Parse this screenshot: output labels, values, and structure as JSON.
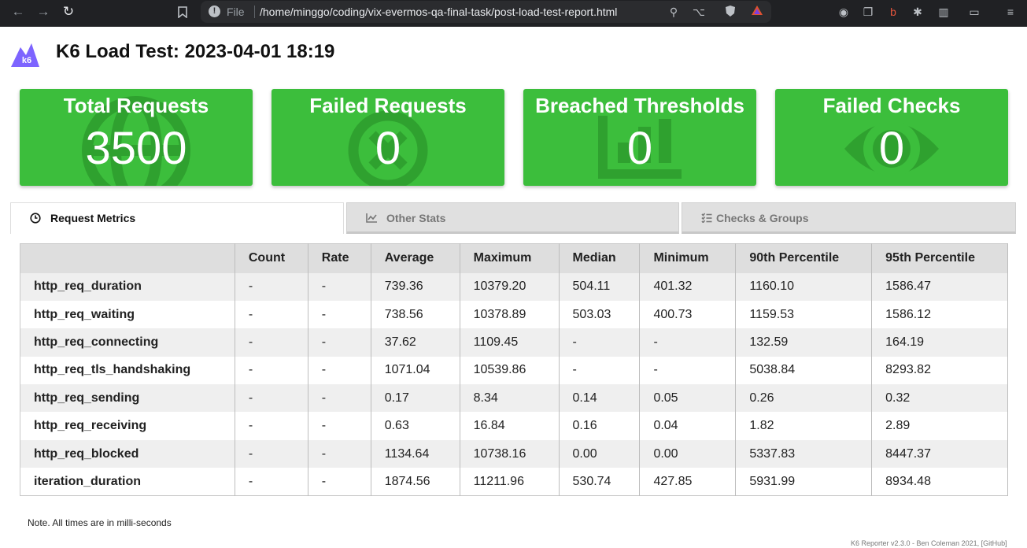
{
  "browser": {
    "file_label": "File",
    "url": "/home/minggo/coding/vix-evermos-qa-final-task/post-load-test-report.html"
  },
  "header": {
    "logo_text": "k6",
    "title": "K6 Load Test: 2023-04-01 18:19"
  },
  "cards": [
    {
      "title": "Total Requests",
      "value": "3500",
      "icon": "globe-icon"
    },
    {
      "title": "Failed Requests",
      "value": "0",
      "icon": "x-circle-icon"
    },
    {
      "title": "Breached Thresholds",
      "value": "0",
      "icon": "bar-chart-icon"
    },
    {
      "title": "Failed Checks",
      "value": "0",
      "icon": "eye-icon"
    }
  ],
  "tabs": [
    {
      "label": "Request Metrics",
      "icon": "clock-icon",
      "active": true
    },
    {
      "label": "Other Stats",
      "icon": "line-chart-icon",
      "active": false
    },
    {
      "label": "Checks & Groups",
      "icon": "checklist-icon",
      "active": false
    }
  ],
  "table": {
    "headers": [
      "",
      "Count",
      "Rate",
      "Average",
      "Maximum",
      "Median",
      "Minimum",
      "90th Percentile",
      "95th Percentile"
    ],
    "rows": [
      [
        "http_req_duration",
        "-",
        "-",
        "739.36",
        "10379.20",
        "504.11",
        "401.32",
        "1160.10",
        "1586.47"
      ],
      [
        "http_req_waiting",
        "-",
        "-",
        "738.56",
        "10378.89",
        "503.03",
        "400.73",
        "1159.53",
        "1586.12"
      ],
      [
        "http_req_connecting",
        "-",
        "-",
        "37.62",
        "1109.45",
        "-",
        "-",
        "132.59",
        "164.19"
      ],
      [
        "http_req_tls_handshaking",
        "-",
        "-",
        "1071.04",
        "10539.86",
        "-",
        "-",
        "5038.84",
        "8293.82"
      ],
      [
        "http_req_sending",
        "-",
        "-",
        "0.17",
        "8.34",
        "0.14",
        "0.05",
        "0.26",
        "0.32"
      ],
      [
        "http_req_receiving",
        "-",
        "-",
        "0.63",
        "16.84",
        "0.16",
        "0.04",
        "1.82",
        "2.89"
      ],
      [
        "http_req_blocked",
        "-",
        "-",
        "1134.64",
        "10738.16",
        "0.00",
        "0.00",
        "5337.83",
        "8447.37"
      ],
      [
        "iteration_duration",
        "-",
        "-",
        "1874.56",
        "11211.96",
        "530.74",
        "427.85",
        "5931.99",
        "8934.48"
      ]
    ]
  },
  "note": "Note. All times are in milli-seconds",
  "footer": "K6 Reporter v2.3.0 - Ben Coleman 2021, [GitHub]",
  "colors": {
    "card_green": "#3cbe3c",
    "card_icon_green": "#2fa12f",
    "logo_purple": "#7d64ff"
  }
}
